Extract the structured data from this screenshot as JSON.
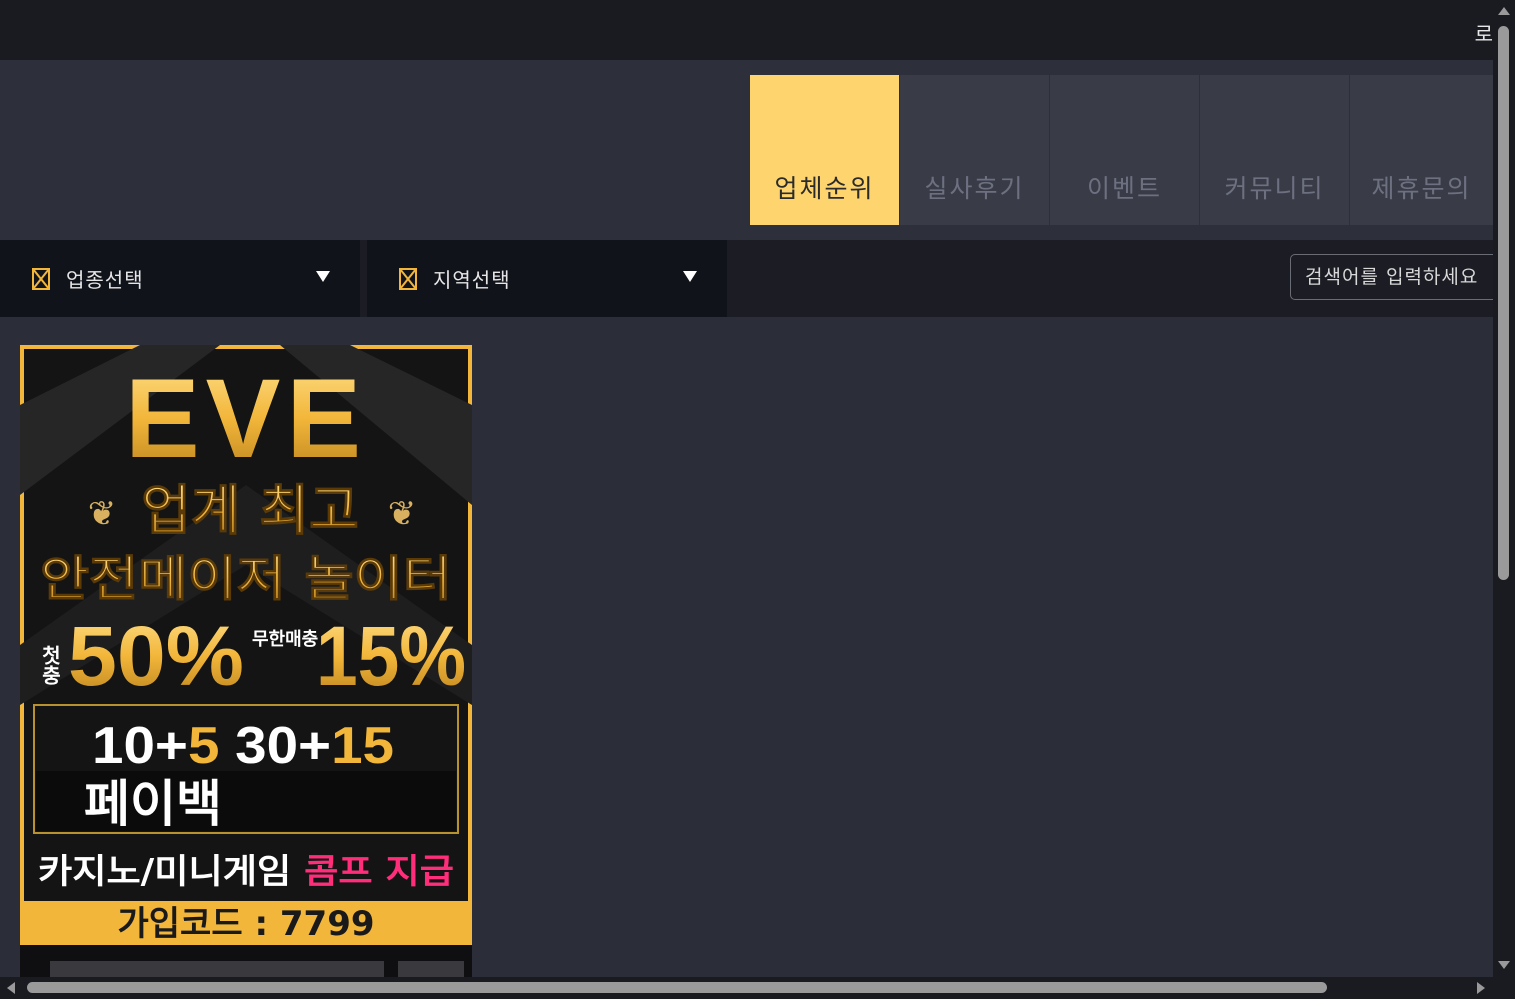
{
  "topbar": {
    "login_label": "로"
  },
  "nav": {
    "items": [
      {
        "label": "업체순위"
      },
      {
        "label": "실사후기"
      },
      {
        "label": "이벤트"
      },
      {
        "label": "커뮤니티"
      },
      {
        "label": "제휴문의"
      }
    ]
  },
  "filters": {
    "category_label": "업종선택",
    "region_label": "지역선택",
    "search_placeholder": "검색어를 입력하세요"
  },
  "banner": {
    "logo": "EVE",
    "line1": "업계 최고",
    "line2": "안전메이저 놀이터",
    "first": "첫충",
    "first_pct": "50%",
    "unlimited": "무한매충",
    "unlimited_pct": "15%",
    "payback_nums_a": "10+",
    "payback_nums_b": "5",
    "payback_nums_c": " 30+",
    "payback_nums_d": "15",
    "payback": "페이백",
    "comp_a": "카지노/미니게임 ",
    "comp_b": "콤프 지급",
    "code": "가입코드 : 7799"
  },
  "colors": {
    "accent": "#fed46f",
    "gold": "#f2b63a",
    "pink": "#ff2d7a"
  }
}
